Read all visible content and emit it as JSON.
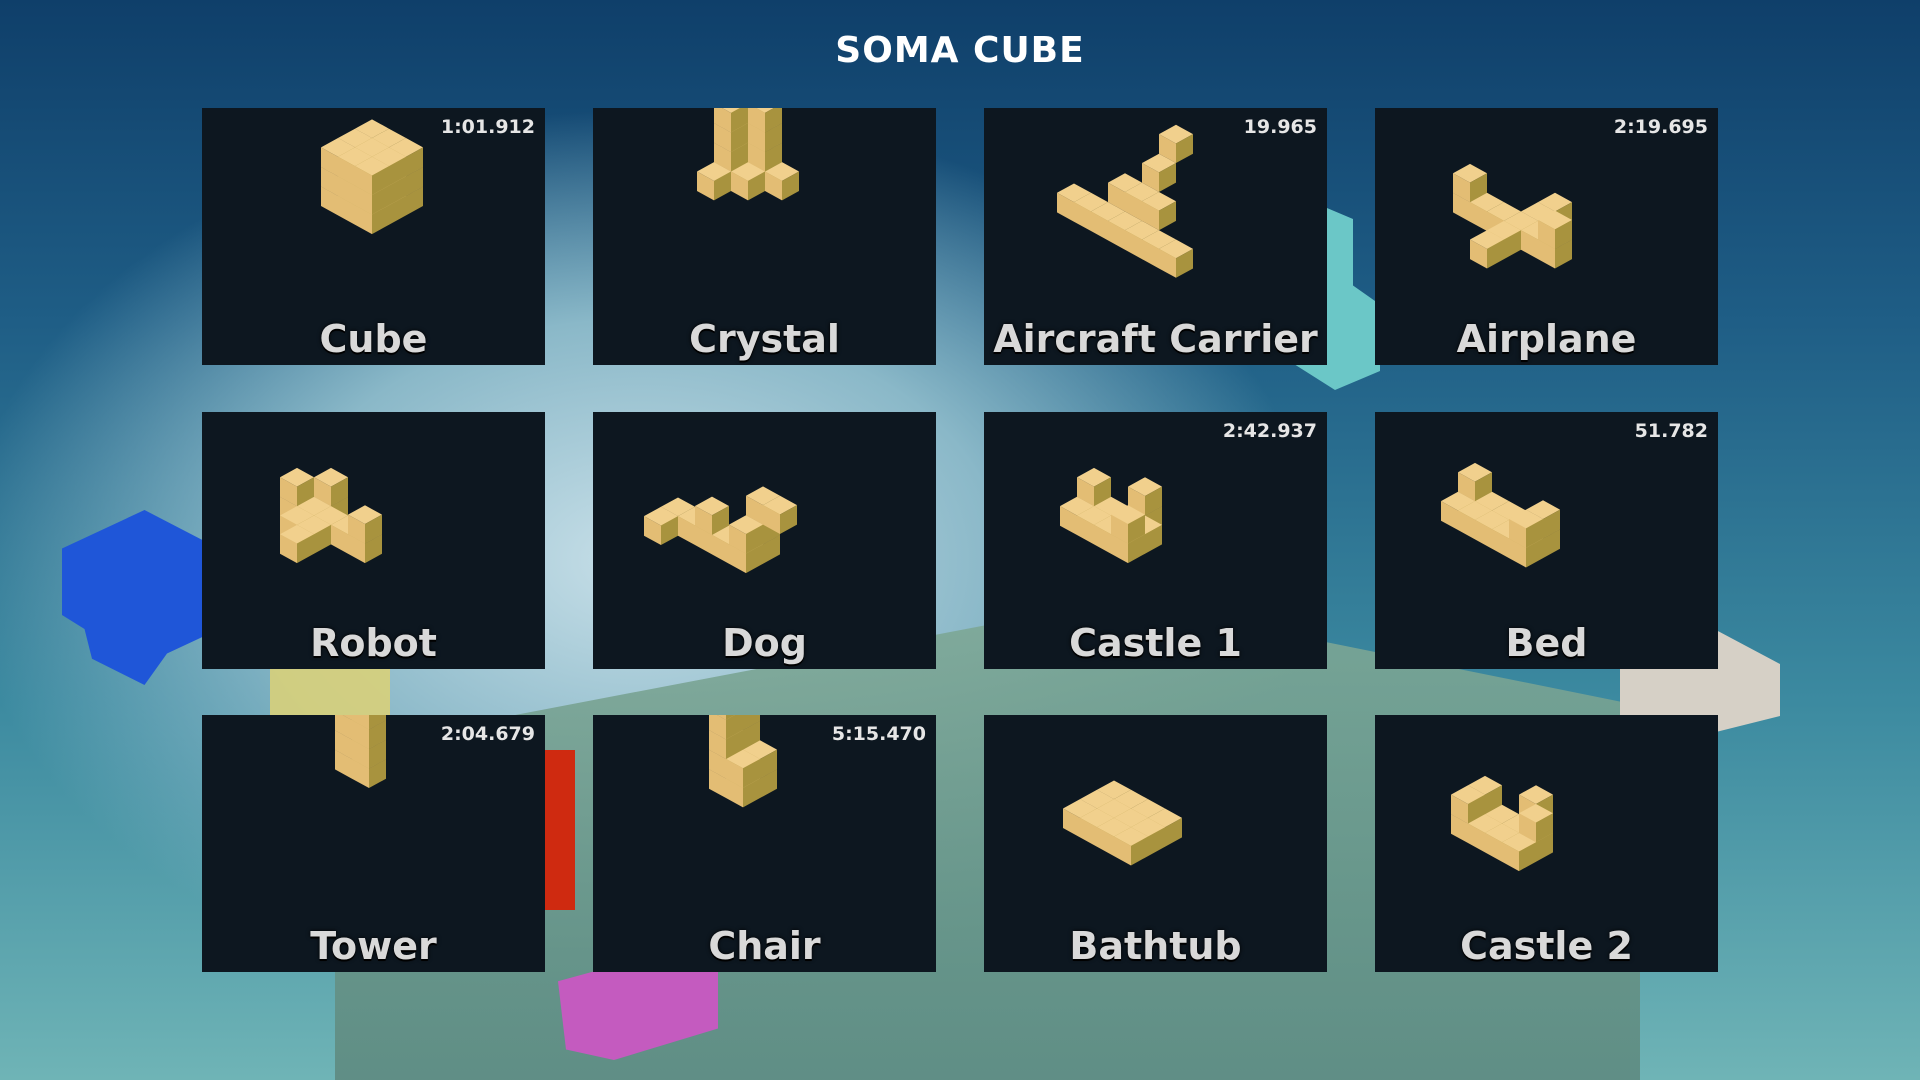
{
  "title": "SOMA CUBE",
  "puzzles": [
    {
      "name": "Cube",
      "time": "1:01.912",
      "icon": "cube-shape-icon"
    },
    {
      "name": "Crystal",
      "time": "",
      "icon": "crystal-shape-icon"
    },
    {
      "name": "Aircraft Carrier",
      "time": "19.965",
      "icon": "aircraft-carrier-shape-icon"
    },
    {
      "name": "Airplane",
      "time": "2:19.695",
      "icon": "airplane-shape-icon"
    },
    {
      "name": "Robot",
      "time": "",
      "icon": "robot-shape-icon"
    },
    {
      "name": "Dog",
      "time": "",
      "icon": "dog-shape-icon"
    },
    {
      "name": "Castle 1",
      "time": "2:42.937",
      "icon": "castle-shape-icon"
    },
    {
      "name": "Bed",
      "time": "51.782",
      "icon": "bed-shape-icon"
    },
    {
      "name": "Tower",
      "time": "2:04.679",
      "icon": "tower-shape-icon"
    },
    {
      "name": "Chair",
      "time": "5:15.470",
      "icon": "chair-shape-icon"
    },
    {
      "name": "Bathtub",
      "time": "",
      "icon": "bathtub-shape-icon"
    },
    {
      "name": "Castle 2",
      "time": "",
      "icon": "castle-2-shape-icon"
    }
  ],
  "colors": {
    "card_bg": "#0d1720",
    "shape_top": "#f1d08d",
    "shape_left": "#e3bd74",
    "shape_right": "#a8933e"
  }
}
